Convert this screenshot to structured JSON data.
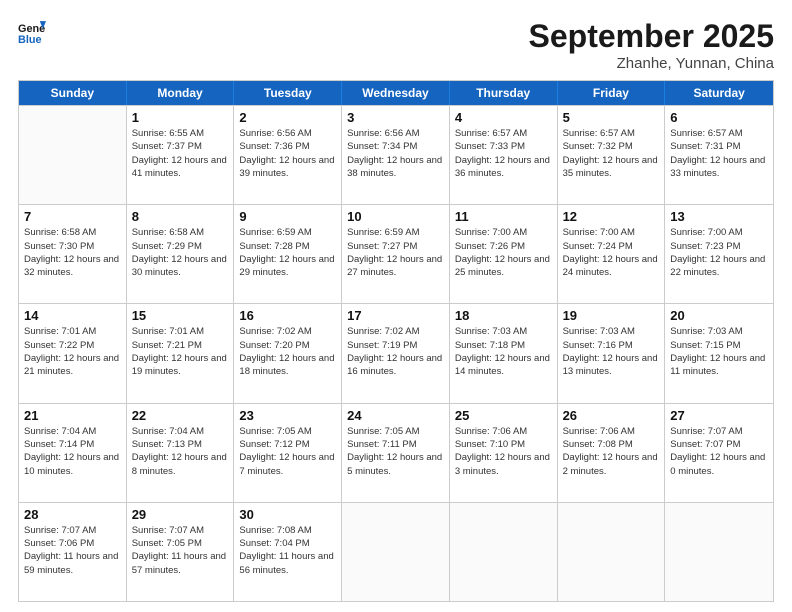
{
  "header": {
    "logo_line1": "General",
    "logo_line2": "Blue",
    "month": "September 2025",
    "location": "Zhanhe, Yunnan, China"
  },
  "days_of_week": [
    "Sunday",
    "Monday",
    "Tuesday",
    "Wednesday",
    "Thursday",
    "Friday",
    "Saturday"
  ],
  "weeks": [
    [
      {
        "day": null
      },
      {
        "day": 1,
        "sunrise": "6:55 AM",
        "sunset": "7:37 PM",
        "daylight": "12 hours and 41 minutes."
      },
      {
        "day": 2,
        "sunrise": "6:56 AM",
        "sunset": "7:36 PM",
        "daylight": "12 hours and 39 minutes."
      },
      {
        "day": 3,
        "sunrise": "6:56 AM",
        "sunset": "7:34 PM",
        "daylight": "12 hours and 38 minutes."
      },
      {
        "day": 4,
        "sunrise": "6:57 AM",
        "sunset": "7:33 PM",
        "daylight": "12 hours and 36 minutes."
      },
      {
        "day": 5,
        "sunrise": "6:57 AM",
        "sunset": "7:32 PM",
        "daylight": "12 hours and 35 minutes."
      },
      {
        "day": 6,
        "sunrise": "6:57 AM",
        "sunset": "7:31 PM",
        "daylight": "12 hours and 33 minutes."
      }
    ],
    [
      {
        "day": 7,
        "sunrise": "6:58 AM",
        "sunset": "7:30 PM",
        "daylight": "12 hours and 32 minutes."
      },
      {
        "day": 8,
        "sunrise": "6:58 AM",
        "sunset": "7:29 PM",
        "daylight": "12 hours and 30 minutes."
      },
      {
        "day": 9,
        "sunrise": "6:59 AM",
        "sunset": "7:28 PM",
        "daylight": "12 hours and 29 minutes."
      },
      {
        "day": 10,
        "sunrise": "6:59 AM",
        "sunset": "7:27 PM",
        "daylight": "12 hours and 27 minutes."
      },
      {
        "day": 11,
        "sunrise": "7:00 AM",
        "sunset": "7:26 PM",
        "daylight": "12 hours and 25 minutes."
      },
      {
        "day": 12,
        "sunrise": "7:00 AM",
        "sunset": "7:24 PM",
        "daylight": "12 hours and 24 minutes."
      },
      {
        "day": 13,
        "sunrise": "7:00 AM",
        "sunset": "7:23 PM",
        "daylight": "12 hours and 22 minutes."
      }
    ],
    [
      {
        "day": 14,
        "sunrise": "7:01 AM",
        "sunset": "7:22 PM",
        "daylight": "12 hours and 21 minutes."
      },
      {
        "day": 15,
        "sunrise": "7:01 AM",
        "sunset": "7:21 PM",
        "daylight": "12 hours and 19 minutes."
      },
      {
        "day": 16,
        "sunrise": "7:02 AM",
        "sunset": "7:20 PM",
        "daylight": "12 hours and 18 minutes."
      },
      {
        "day": 17,
        "sunrise": "7:02 AM",
        "sunset": "7:19 PM",
        "daylight": "12 hours and 16 minutes."
      },
      {
        "day": 18,
        "sunrise": "7:03 AM",
        "sunset": "7:18 PM",
        "daylight": "12 hours and 14 minutes."
      },
      {
        "day": 19,
        "sunrise": "7:03 AM",
        "sunset": "7:16 PM",
        "daylight": "12 hours and 13 minutes."
      },
      {
        "day": 20,
        "sunrise": "7:03 AM",
        "sunset": "7:15 PM",
        "daylight": "12 hours and 11 minutes."
      }
    ],
    [
      {
        "day": 21,
        "sunrise": "7:04 AM",
        "sunset": "7:14 PM",
        "daylight": "12 hours and 10 minutes."
      },
      {
        "day": 22,
        "sunrise": "7:04 AM",
        "sunset": "7:13 PM",
        "daylight": "12 hours and 8 minutes."
      },
      {
        "day": 23,
        "sunrise": "7:05 AM",
        "sunset": "7:12 PM",
        "daylight": "12 hours and 7 minutes."
      },
      {
        "day": 24,
        "sunrise": "7:05 AM",
        "sunset": "7:11 PM",
        "daylight": "12 hours and 5 minutes."
      },
      {
        "day": 25,
        "sunrise": "7:06 AM",
        "sunset": "7:10 PM",
        "daylight": "12 hours and 3 minutes."
      },
      {
        "day": 26,
        "sunrise": "7:06 AM",
        "sunset": "7:08 PM",
        "daylight": "12 hours and 2 minutes."
      },
      {
        "day": 27,
        "sunrise": "7:07 AM",
        "sunset": "7:07 PM",
        "daylight": "12 hours and 0 minutes."
      }
    ],
    [
      {
        "day": 28,
        "sunrise": "7:07 AM",
        "sunset": "7:06 PM",
        "daylight": "11 hours and 59 minutes."
      },
      {
        "day": 29,
        "sunrise": "7:07 AM",
        "sunset": "7:05 PM",
        "daylight": "11 hours and 57 minutes."
      },
      {
        "day": 30,
        "sunrise": "7:08 AM",
        "sunset": "7:04 PM",
        "daylight": "11 hours and 56 minutes."
      },
      {
        "day": null
      },
      {
        "day": null
      },
      {
        "day": null
      },
      {
        "day": null
      }
    ]
  ]
}
